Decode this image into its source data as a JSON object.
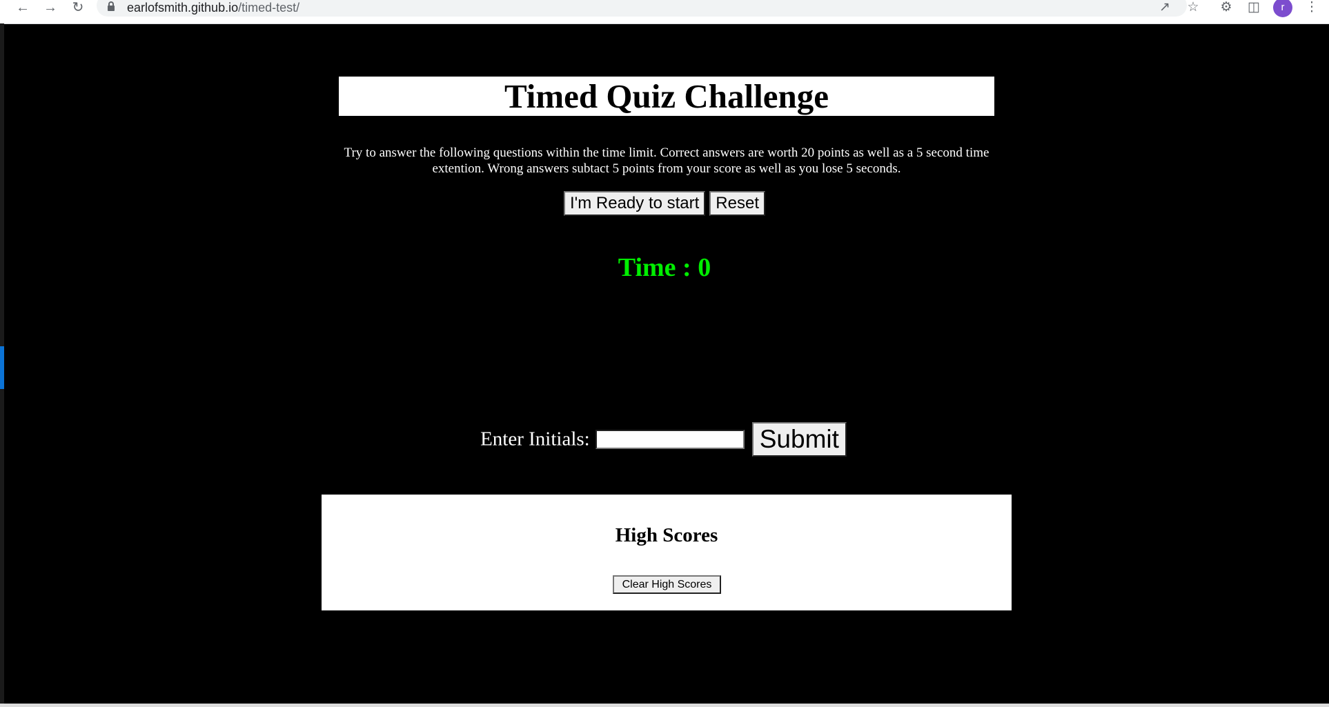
{
  "browser": {
    "url_host": "earlofsmith.github.io",
    "url_path": "/timed-test/",
    "avatar_initial": "r"
  },
  "page": {
    "title": "Timed Quiz Challenge",
    "instructions": "Try to answer the following questions within the time limit. Correct answers are worth 20 points as well as a 5 second time extention. Wrong answers subtact 5 points from your score as well as you lose 5 seconds.",
    "start_label": "I'm Ready to start",
    "reset_label": "Reset",
    "time_label": "Time : 0",
    "initials_label": "Enter Initials:",
    "initials_value": "",
    "submit_label": "Submit",
    "high_scores_heading": "High Scores",
    "clear_label": "Clear High Scores"
  },
  "colors": {
    "page_background": "#000000",
    "timer": "#00ee00",
    "avatar": "#7c4dce"
  }
}
